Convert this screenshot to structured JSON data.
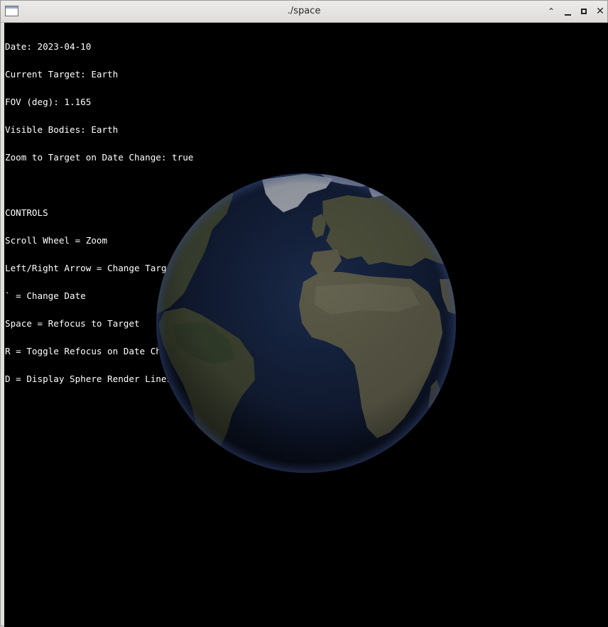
{
  "window": {
    "title": "./space",
    "buttons": {
      "shade_glyph": "⌃",
      "close_glyph": "✕"
    }
  },
  "hud": {
    "date_line": "Date: 2023-04-10",
    "target_line": "Current Target: Earth",
    "fov_line": "FOV (deg): 1.165",
    "visible_line": "Visible Bodies: Earth",
    "zoom_line": "Zoom to Target on Date Change: true",
    "controls_heading": "CONTROLS",
    "controls": [
      "Scroll Wheel = Zoom",
      "Left/Right Arrow = Change Target",
      "` = Change Date",
      "Space = Refocus to Target",
      "R = Toggle Refocus on Date Change",
      "D = Display Sphere Render Lines"
    ]
  },
  "scene": {
    "background": "#000000",
    "ocean_color": "#15223f",
    "land_color": "#4a4a38",
    "ice_color": "#c9ccd0"
  }
}
